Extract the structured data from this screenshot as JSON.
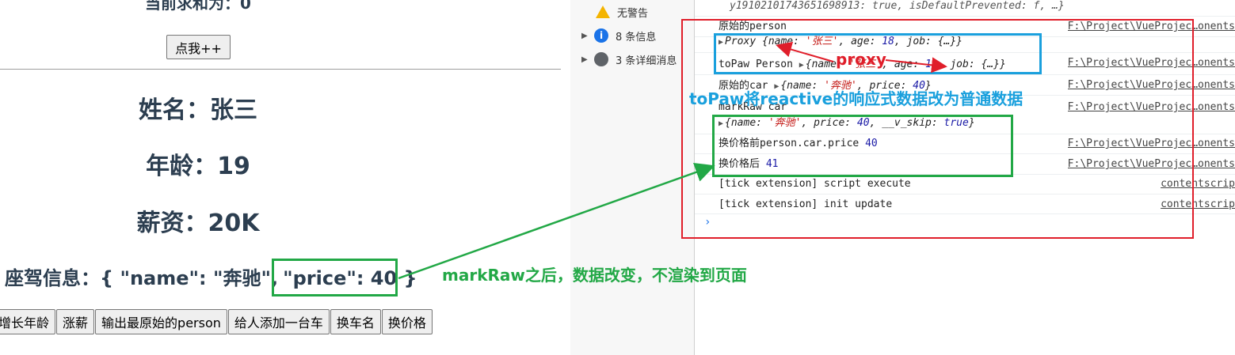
{
  "app": {
    "sum_text": "当前求和为：0",
    "plus_button": "点我++",
    "name_line": "姓名：张三",
    "age_line": "年龄：19",
    "salary_line": "薪资：20K",
    "car_label": "座驾信息：{ \"name\": \"奔驰\",",
    "car_price": "\"price\": 40 }",
    "buttons": [
      "增长年龄",
      "涨薪",
      "输出最原始的person",
      "给人添加一台车",
      "换车名",
      "换价格"
    ]
  },
  "devtools": {
    "sidebar": [
      {
        "icon": "warning-icon",
        "label": "无警告"
      },
      {
        "icon": "info-icon",
        "label": "8 条信息"
      },
      {
        "icon": "bug-icon",
        "label": "3 条详细消息"
      }
    ],
    "top_line": "y19102101743651698913: true, isDefaultPrevented: f, …}",
    "logs": {
      "l1": "原始的person",
      "l2_prefix": "Proxy",
      "l2_body": " {name: ",
      "l2_name": "'张三'",
      "l2_age_key": ", age: ",
      "l2_age": "18",
      "l2_tail": ", job: {…}}",
      "l3_label": "toPaw Person ",
      "l3_body": "{name: ",
      "l3_name": "'张三'",
      "l3_age_key": ", age: ",
      "l3_age": "19",
      "l3_tail": ", job: {…}}",
      "l4_label": "原始的car ",
      "l4_body": "{name: ",
      "l4_name": "'奔驰'",
      "l4_price_key": ", price: ",
      "l4_price": "40",
      "l4_tail": "}",
      "l5": "markRaw car",
      "l6_body": "{name: ",
      "l6_name": "'奔驰'",
      "l6_price_key": ", price: ",
      "l6_price": "40",
      "l6_skip_key": ", __v_skip: ",
      "l6_skip": "true",
      "l6_tail": "}",
      "l7_label": "换价格前person.car.price ",
      "l7_value": "40",
      "l8_label": "换价格后 ",
      "l8_value": "41",
      "l9": "[tick extension] script execute",
      "l10": "[tick extension] init update"
    },
    "sources": {
      "vue": "F:\\Project\\VueProjec…onents",
      "content": "contentscrip"
    },
    "prompt": "›"
  },
  "annotations": {
    "proxy": "proxy",
    "topaw": "toPaw将reactive的响应式数据改为普通数据",
    "markraw": "markRaw之后，数据改变，不渲染到页面",
    "colors": {
      "red": "#e01e2a",
      "blue": "#1aa0dd",
      "green": "#22a846"
    }
  }
}
